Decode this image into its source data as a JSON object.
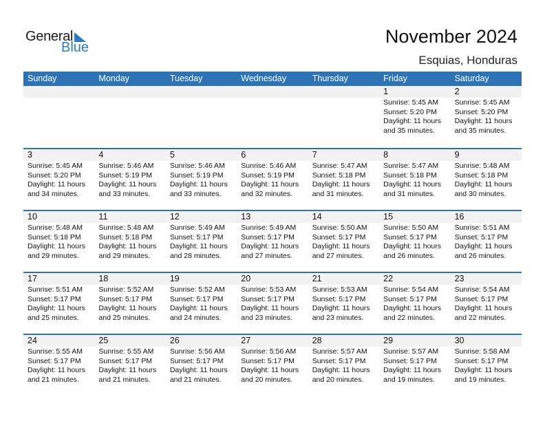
{
  "brand": {
    "name_part1": "General",
    "name_part2": "Blue",
    "accent": "#2e74b5"
  },
  "header": {
    "title": "November 2024",
    "subtitle": "Esquias, Honduras"
  },
  "weekdays": [
    "Sunday",
    "Monday",
    "Tuesday",
    "Wednesday",
    "Thursday",
    "Friday",
    "Saturday"
  ],
  "weeks": [
    [
      null,
      null,
      null,
      null,
      null,
      {
        "day": "1",
        "sunrise": "Sunrise: 5:45 AM",
        "sunset": "Sunset: 5:20 PM",
        "daylight1": "Daylight: 11 hours",
        "daylight2": "and 35 minutes."
      },
      {
        "day": "2",
        "sunrise": "Sunrise: 5:45 AM",
        "sunset": "Sunset: 5:20 PM",
        "daylight1": "Daylight: 11 hours",
        "daylight2": "and 35 minutes."
      }
    ],
    [
      {
        "day": "3",
        "sunrise": "Sunrise: 5:45 AM",
        "sunset": "Sunset: 5:20 PM",
        "daylight1": "Daylight: 11 hours",
        "daylight2": "and 34 minutes."
      },
      {
        "day": "4",
        "sunrise": "Sunrise: 5:46 AM",
        "sunset": "Sunset: 5:19 PM",
        "daylight1": "Daylight: 11 hours",
        "daylight2": "and 33 minutes."
      },
      {
        "day": "5",
        "sunrise": "Sunrise: 5:46 AM",
        "sunset": "Sunset: 5:19 PM",
        "daylight1": "Daylight: 11 hours",
        "daylight2": "and 33 minutes."
      },
      {
        "day": "6",
        "sunrise": "Sunrise: 5:46 AM",
        "sunset": "Sunset: 5:19 PM",
        "daylight1": "Daylight: 11 hours",
        "daylight2": "and 32 minutes."
      },
      {
        "day": "7",
        "sunrise": "Sunrise: 5:47 AM",
        "sunset": "Sunset: 5:18 PM",
        "daylight1": "Daylight: 11 hours",
        "daylight2": "and 31 minutes."
      },
      {
        "day": "8",
        "sunrise": "Sunrise: 5:47 AM",
        "sunset": "Sunset: 5:18 PM",
        "daylight1": "Daylight: 11 hours",
        "daylight2": "and 31 minutes."
      },
      {
        "day": "9",
        "sunrise": "Sunrise: 5:48 AM",
        "sunset": "Sunset: 5:18 PM",
        "daylight1": "Daylight: 11 hours",
        "daylight2": "and 30 minutes."
      }
    ],
    [
      {
        "day": "10",
        "sunrise": "Sunrise: 5:48 AM",
        "sunset": "Sunset: 5:18 PM",
        "daylight1": "Daylight: 11 hours",
        "daylight2": "and 29 minutes."
      },
      {
        "day": "11",
        "sunrise": "Sunrise: 5:48 AM",
        "sunset": "Sunset: 5:18 PM",
        "daylight1": "Daylight: 11 hours",
        "daylight2": "and 29 minutes."
      },
      {
        "day": "12",
        "sunrise": "Sunrise: 5:49 AM",
        "sunset": "Sunset: 5:17 PM",
        "daylight1": "Daylight: 11 hours",
        "daylight2": "and 28 minutes."
      },
      {
        "day": "13",
        "sunrise": "Sunrise: 5:49 AM",
        "sunset": "Sunset: 5:17 PM",
        "daylight1": "Daylight: 11 hours",
        "daylight2": "and 27 minutes."
      },
      {
        "day": "14",
        "sunrise": "Sunrise: 5:50 AM",
        "sunset": "Sunset: 5:17 PM",
        "daylight1": "Daylight: 11 hours",
        "daylight2": "and 27 minutes."
      },
      {
        "day": "15",
        "sunrise": "Sunrise: 5:50 AM",
        "sunset": "Sunset: 5:17 PM",
        "daylight1": "Daylight: 11 hours",
        "daylight2": "and 26 minutes."
      },
      {
        "day": "16",
        "sunrise": "Sunrise: 5:51 AM",
        "sunset": "Sunset: 5:17 PM",
        "daylight1": "Daylight: 11 hours",
        "daylight2": "and 26 minutes."
      }
    ],
    [
      {
        "day": "17",
        "sunrise": "Sunrise: 5:51 AM",
        "sunset": "Sunset: 5:17 PM",
        "daylight1": "Daylight: 11 hours",
        "daylight2": "and 25 minutes."
      },
      {
        "day": "18",
        "sunrise": "Sunrise: 5:52 AM",
        "sunset": "Sunset: 5:17 PM",
        "daylight1": "Daylight: 11 hours",
        "daylight2": "and 25 minutes."
      },
      {
        "day": "19",
        "sunrise": "Sunrise: 5:52 AM",
        "sunset": "Sunset: 5:17 PM",
        "daylight1": "Daylight: 11 hours",
        "daylight2": "and 24 minutes."
      },
      {
        "day": "20",
        "sunrise": "Sunrise: 5:53 AM",
        "sunset": "Sunset: 5:17 PM",
        "daylight1": "Daylight: 11 hours",
        "daylight2": "and 23 minutes."
      },
      {
        "day": "21",
        "sunrise": "Sunrise: 5:53 AM",
        "sunset": "Sunset: 5:17 PM",
        "daylight1": "Daylight: 11 hours",
        "daylight2": "and 23 minutes."
      },
      {
        "day": "22",
        "sunrise": "Sunrise: 5:54 AM",
        "sunset": "Sunset: 5:17 PM",
        "daylight1": "Daylight: 11 hours",
        "daylight2": "and 22 minutes."
      },
      {
        "day": "23",
        "sunrise": "Sunrise: 5:54 AM",
        "sunset": "Sunset: 5:17 PM",
        "daylight1": "Daylight: 11 hours",
        "daylight2": "and 22 minutes."
      }
    ],
    [
      {
        "day": "24",
        "sunrise": "Sunrise: 5:55 AM",
        "sunset": "Sunset: 5:17 PM",
        "daylight1": "Daylight: 11 hours",
        "daylight2": "and 21 minutes."
      },
      {
        "day": "25",
        "sunrise": "Sunrise: 5:55 AM",
        "sunset": "Sunset: 5:17 PM",
        "daylight1": "Daylight: 11 hours",
        "daylight2": "and 21 minutes."
      },
      {
        "day": "26",
        "sunrise": "Sunrise: 5:56 AM",
        "sunset": "Sunset: 5:17 PM",
        "daylight1": "Daylight: 11 hours",
        "daylight2": "and 21 minutes."
      },
      {
        "day": "27",
        "sunrise": "Sunrise: 5:56 AM",
        "sunset": "Sunset: 5:17 PM",
        "daylight1": "Daylight: 11 hours",
        "daylight2": "and 20 minutes."
      },
      {
        "day": "28",
        "sunrise": "Sunrise: 5:57 AM",
        "sunset": "Sunset: 5:17 PM",
        "daylight1": "Daylight: 11 hours",
        "daylight2": "and 20 minutes."
      },
      {
        "day": "29",
        "sunrise": "Sunrise: 5:57 AM",
        "sunset": "Sunset: 5:17 PM",
        "daylight1": "Daylight: 11 hours",
        "daylight2": "and 19 minutes."
      },
      {
        "day": "30",
        "sunrise": "Sunrise: 5:58 AM",
        "sunset": "Sunset: 5:17 PM",
        "daylight1": "Daylight: 11 hours",
        "daylight2": "and 19 minutes."
      }
    ]
  ]
}
